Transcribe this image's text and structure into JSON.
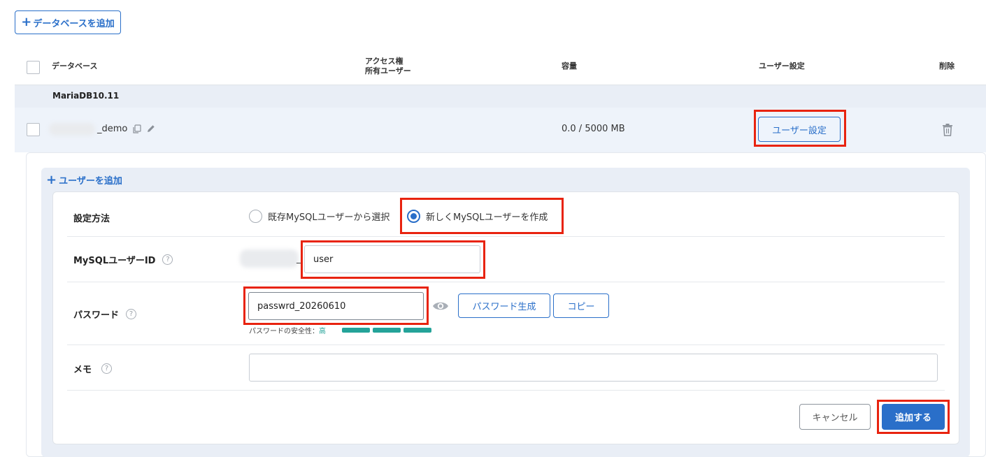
{
  "toolbar": {
    "add_database_label": "データベースを追加"
  },
  "table": {
    "headers": {
      "database": "データベース",
      "access_line1": "アクセス権",
      "access_line2": "所有ユーザー",
      "capacity": "容量",
      "user_settings": "ユーザー設定",
      "delete": "削除"
    },
    "group_name": "MariaDB10.11",
    "row": {
      "name_suffix": "_demo",
      "capacity": "0.0 / 5000 MB",
      "user_settings_button": "ユーザー設定"
    }
  },
  "add_user": {
    "title": "ユーザーを追加",
    "method_label": "設定方法",
    "method_options": [
      "既存MySQLユーザーから選択",
      "新しくMySQLユーザーを作成"
    ],
    "method_selected_index": 1,
    "userid_label": "MySQLユーザーID",
    "userid_prefix": "_",
    "userid_value": "user",
    "password_label": "パスワード",
    "password_value": "passwrd_20260610",
    "generate_button": "パスワード生成",
    "copy_button": "コピー",
    "strength_label": "パスワードの安全性：",
    "strength_value": "高",
    "memo_label": "メモ",
    "memo_value": "",
    "cancel_button": "キャンセル",
    "submit_button": "追加する",
    "help_glyph": "?"
  },
  "colors": {
    "accent": "#2a6fc9",
    "highlight": "#e8230f",
    "strength": "#24a399"
  }
}
